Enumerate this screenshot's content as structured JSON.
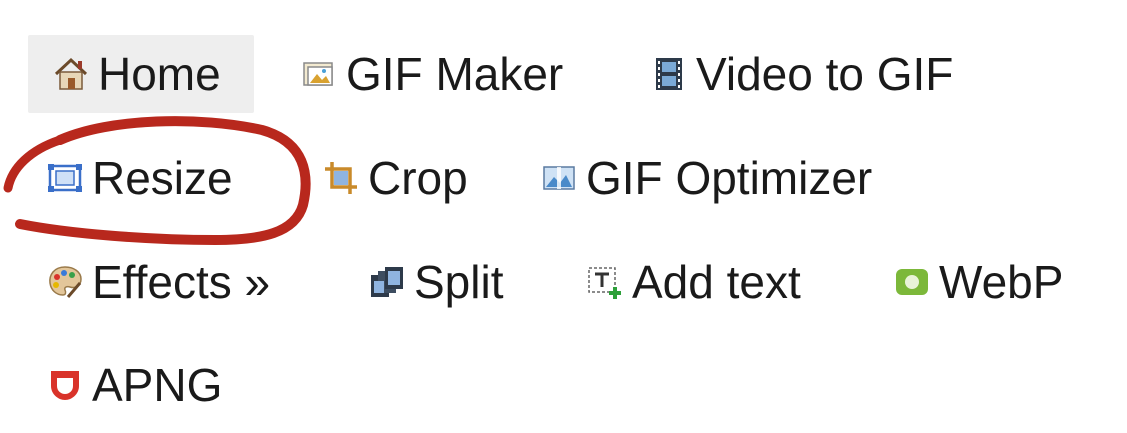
{
  "menu": {
    "items": [
      {
        "label": "Home",
        "icon": "house-icon",
        "active": true
      },
      {
        "label": "GIF Maker",
        "icon": "image-stack-icon"
      },
      {
        "label": "Video to GIF",
        "icon": "film-strip-icon"
      },
      {
        "label": "Resize",
        "icon": "resize-icon"
      },
      {
        "label": "Crop",
        "icon": "crop-icon"
      },
      {
        "label": "GIF Optimizer",
        "icon": "optimize-icon"
      },
      {
        "label": "Effects »",
        "icon": "palette-icon"
      },
      {
        "label": "Split",
        "icon": "split-frames-icon"
      },
      {
        "label": "Add text",
        "icon": "add-text-icon"
      },
      {
        "label": "WebP",
        "icon": "webp-icon"
      },
      {
        "label": "APNG",
        "icon": "apng-icon"
      }
    ]
  },
  "annotation": {
    "type": "hand-drawn circle",
    "target": "Resize",
    "color": "#b8281d"
  }
}
